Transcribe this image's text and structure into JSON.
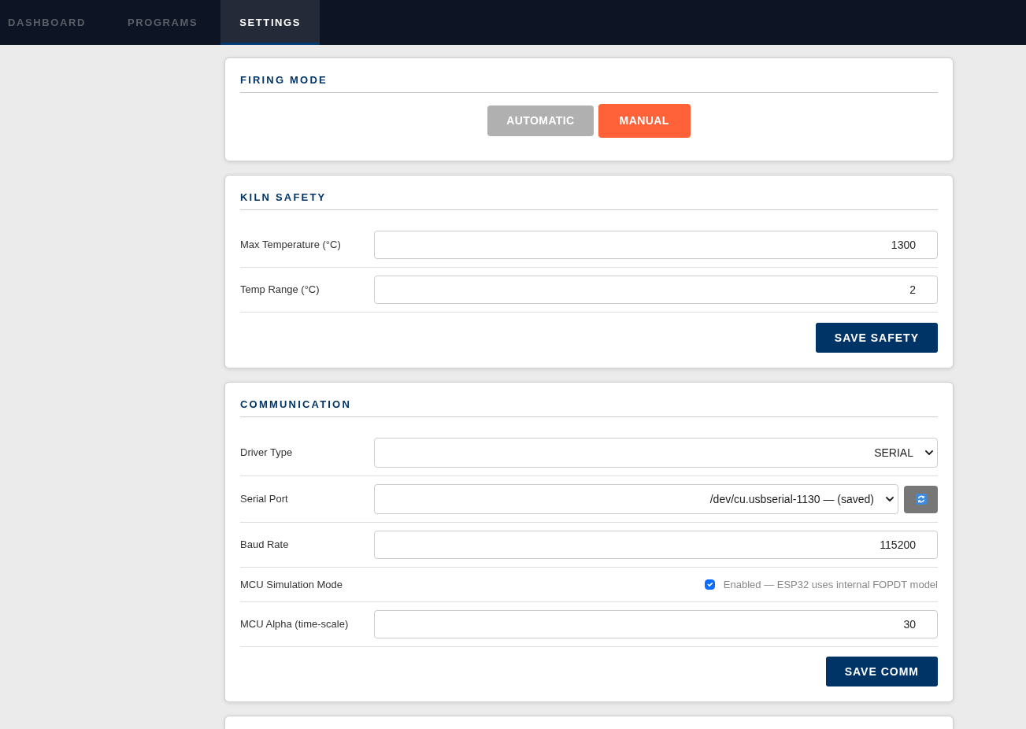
{
  "tabs": [
    {
      "label": "DASHBOARD",
      "selected": false
    },
    {
      "label": "PROGRAMS",
      "selected": false
    },
    {
      "label": "SETTINGS",
      "selected": true
    }
  ],
  "sections": [
    {
      "kind": "mode",
      "title": "FIRING MODE",
      "options": [
        {
          "label": "AUTOMATIC",
          "selected": false
        },
        {
          "label": "MANUAL",
          "selected": true
        }
      ]
    },
    {
      "kind": "form",
      "title": "KILN SAFETY",
      "rows": [
        {
          "kind": "input",
          "label": "Max Temperature (°C)",
          "value": "1300"
        },
        {
          "kind": "input",
          "label": "Temp Range (°C)",
          "value": "2"
        }
      ],
      "save_button": "SAVE SAFETY"
    },
    {
      "kind": "form",
      "title": "COMMUNICATION",
      "rows": [
        {
          "kind": "select",
          "label": "Driver Type",
          "value": "SERIAL"
        },
        {
          "kind": "select_refresh",
          "label": "Serial Port",
          "value": "/dev/cu.usbserial-1130 — (saved)"
        },
        {
          "kind": "input",
          "label": "Baud Rate",
          "value": "115200"
        },
        {
          "kind": "checkbox",
          "label": "MCU Simulation Mode",
          "checked": true,
          "text": "Enabled — ESP32 uses internal FOPDT model"
        },
        {
          "kind": "input",
          "label": "MCU Alpha (time-scale)",
          "value": "30"
        }
      ],
      "save_button": "SAVE COMM"
    },
    {
      "kind": "partial"
    }
  ]
}
